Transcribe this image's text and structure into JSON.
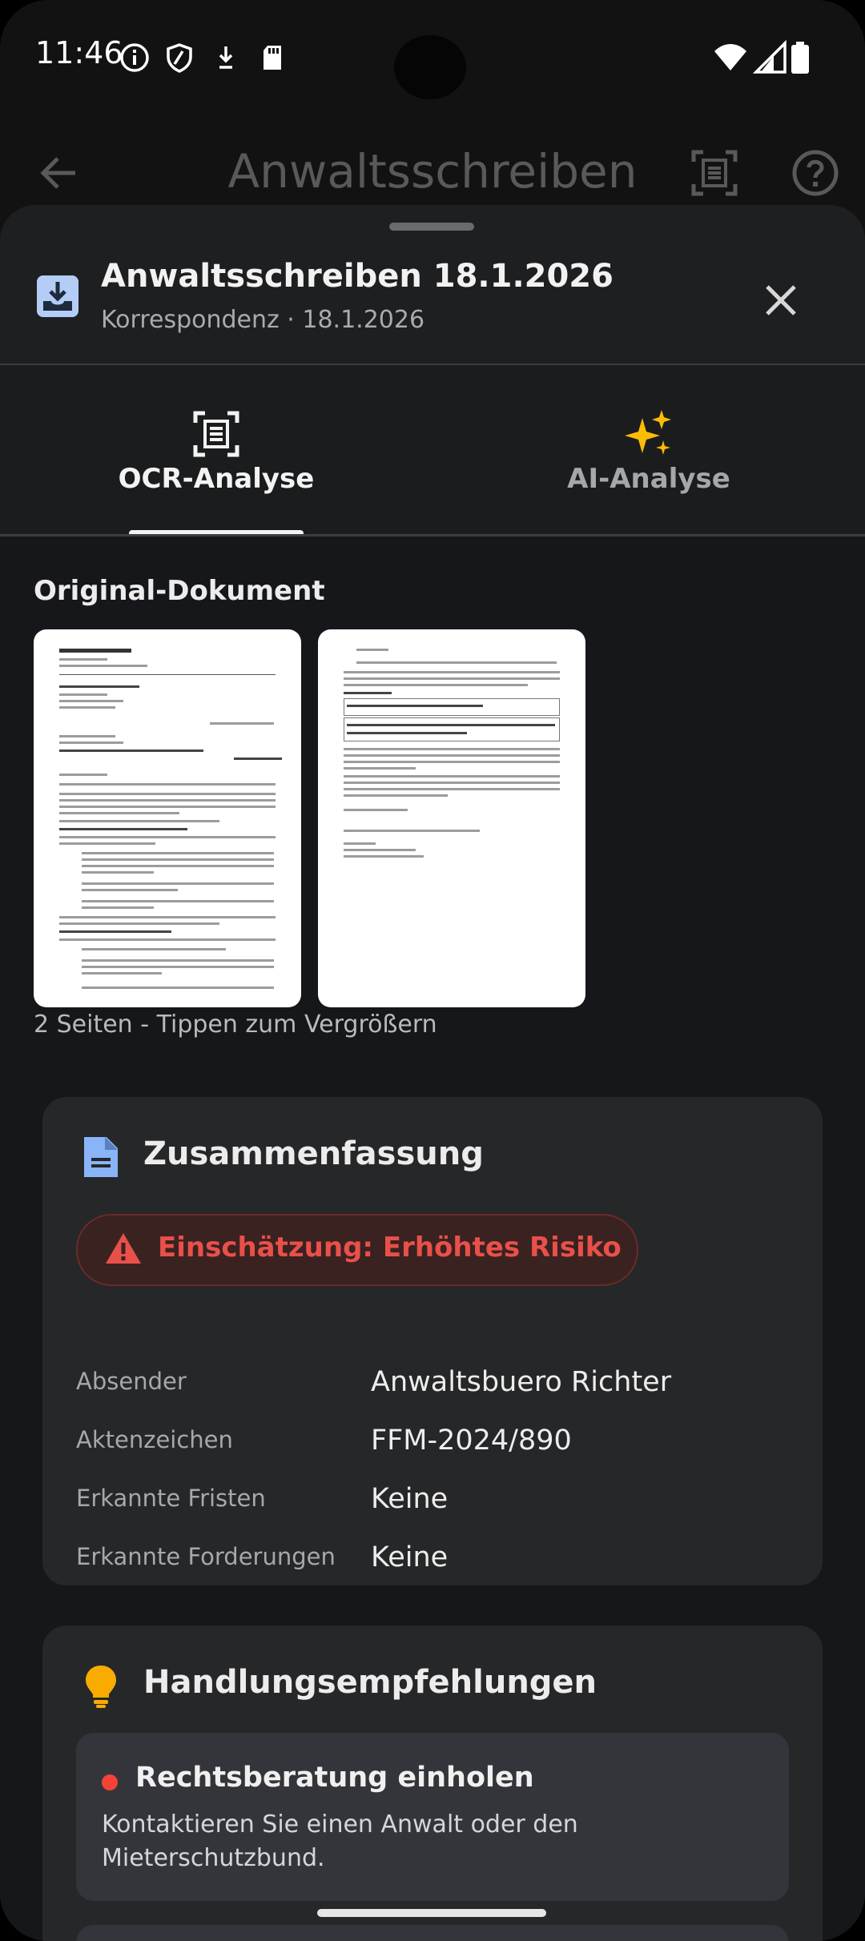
{
  "status_bar": {
    "time": "11:46",
    "left_icons": [
      "info-icon",
      "shield-icon",
      "download-status-icon",
      "sd-card-icon"
    ],
    "right_icons": [
      "wifi-icon",
      "signal-icon",
      "battery-icon"
    ]
  },
  "app_bar": {
    "title": "Anwaltsschreiben"
  },
  "sheet": {
    "title": "Anwaltsschreiben 18.1.2026",
    "subtitle": "Korrespondenz · 18.1.2026"
  },
  "tabs": [
    {
      "label": "OCR-Analyse",
      "icon": "document-scan-icon",
      "selected": true
    },
    {
      "label": "AI-Analyse",
      "icon": "sparkles-icon",
      "selected": false
    }
  ],
  "original": {
    "title": "Original-Dokument",
    "hint": "2 Seiten - Tippen zum Vergrößern"
  },
  "summary": {
    "title": "Zusammenfassung",
    "risk_label": "Einschätzung: Erhöhtes Risiko",
    "rows": [
      {
        "label": "Absender",
        "value": "Anwaltsbuero Richter"
      },
      {
        "label": "Aktenzeichen",
        "value": "FFM-2024/890"
      },
      {
        "label": "Erkannte Fristen",
        "value": "Keine"
      },
      {
        "label": "Erkannte Forderungen",
        "value": "Keine"
      }
    ]
  },
  "recommendations": {
    "title": "Handlungsempfehlungen",
    "items": [
      {
        "title": "Rechtsberatung einholen",
        "description": "Kontaktieren Sie einen Anwalt oder den Mieterschutzbund."
      }
    ]
  },
  "colors": {
    "accent_risk": "#e9504a",
    "summary_icon": "#8ab4f8",
    "bulb_icon": "#f9ab00",
    "sparkle_icon": "#fbbc04",
    "priority_dot": "#f44336"
  }
}
